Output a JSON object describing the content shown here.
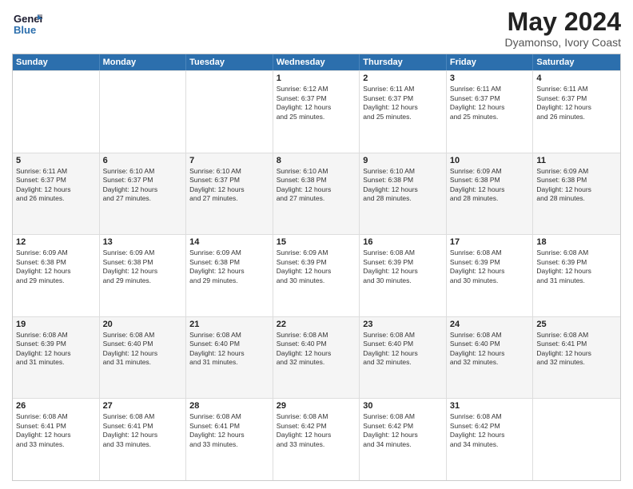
{
  "header": {
    "month_title": "May 2024",
    "location": "Dyamonso, Ivory Coast",
    "logo_general": "General",
    "logo_blue": "Blue"
  },
  "weekdays": [
    "Sunday",
    "Monday",
    "Tuesday",
    "Wednesday",
    "Thursday",
    "Friday",
    "Saturday"
  ],
  "rows": [
    [
      {
        "day": "",
        "info": ""
      },
      {
        "day": "",
        "info": ""
      },
      {
        "day": "",
        "info": ""
      },
      {
        "day": "1",
        "info": "Sunrise: 6:12 AM\nSunset: 6:37 PM\nDaylight: 12 hours\nand 25 minutes."
      },
      {
        "day": "2",
        "info": "Sunrise: 6:11 AM\nSunset: 6:37 PM\nDaylight: 12 hours\nand 25 minutes."
      },
      {
        "day": "3",
        "info": "Sunrise: 6:11 AM\nSunset: 6:37 PM\nDaylight: 12 hours\nand 25 minutes."
      },
      {
        "day": "4",
        "info": "Sunrise: 6:11 AM\nSunset: 6:37 PM\nDaylight: 12 hours\nand 26 minutes."
      }
    ],
    [
      {
        "day": "5",
        "info": "Sunrise: 6:11 AM\nSunset: 6:37 PM\nDaylight: 12 hours\nand 26 minutes."
      },
      {
        "day": "6",
        "info": "Sunrise: 6:10 AM\nSunset: 6:37 PM\nDaylight: 12 hours\nand 27 minutes."
      },
      {
        "day": "7",
        "info": "Sunrise: 6:10 AM\nSunset: 6:37 PM\nDaylight: 12 hours\nand 27 minutes."
      },
      {
        "day": "8",
        "info": "Sunrise: 6:10 AM\nSunset: 6:38 PM\nDaylight: 12 hours\nand 27 minutes."
      },
      {
        "day": "9",
        "info": "Sunrise: 6:10 AM\nSunset: 6:38 PM\nDaylight: 12 hours\nand 28 minutes."
      },
      {
        "day": "10",
        "info": "Sunrise: 6:09 AM\nSunset: 6:38 PM\nDaylight: 12 hours\nand 28 minutes."
      },
      {
        "day": "11",
        "info": "Sunrise: 6:09 AM\nSunset: 6:38 PM\nDaylight: 12 hours\nand 28 minutes."
      }
    ],
    [
      {
        "day": "12",
        "info": "Sunrise: 6:09 AM\nSunset: 6:38 PM\nDaylight: 12 hours\nand 29 minutes."
      },
      {
        "day": "13",
        "info": "Sunrise: 6:09 AM\nSunset: 6:38 PM\nDaylight: 12 hours\nand 29 minutes."
      },
      {
        "day": "14",
        "info": "Sunrise: 6:09 AM\nSunset: 6:38 PM\nDaylight: 12 hours\nand 29 minutes."
      },
      {
        "day": "15",
        "info": "Sunrise: 6:09 AM\nSunset: 6:39 PM\nDaylight: 12 hours\nand 30 minutes."
      },
      {
        "day": "16",
        "info": "Sunrise: 6:08 AM\nSunset: 6:39 PM\nDaylight: 12 hours\nand 30 minutes."
      },
      {
        "day": "17",
        "info": "Sunrise: 6:08 AM\nSunset: 6:39 PM\nDaylight: 12 hours\nand 30 minutes."
      },
      {
        "day": "18",
        "info": "Sunrise: 6:08 AM\nSunset: 6:39 PM\nDaylight: 12 hours\nand 31 minutes."
      }
    ],
    [
      {
        "day": "19",
        "info": "Sunrise: 6:08 AM\nSunset: 6:39 PM\nDaylight: 12 hours\nand 31 minutes."
      },
      {
        "day": "20",
        "info": "Sunrise: 6:08 AM\nSunset: 6:40 PM\nDaylight: 12 hours\nand 31 minutes."
      },
      {
        "day": "21",
        "info": "Sunrise: 6:08 AM\nSunset: 6:40 PM\nDaylight: 12 hours\nand 31 minutes."
      },
      {
        "day": "22",
        "info": "Sunrise: 6:08 AM\nSunset: 6:40 PM\nDaylight: 12 hours\nand 32 minutes."
      },
      {
        "day": "23",
        "info": "Sunrise: 6:08 AM\nSunset: 6:40 PM\nDaylight: 12 hours\nand 32 minutes."
      },
      {
        "day": "24",
        "info": "Sunrise: 6:08 AM\nSunset: 6:40 PM\nDaylight: 12 hours\nand 32 minutes."
      },
      {
        "day": "25",
        "info": "Sunrise: 6:08 AM\nSunset: 6:41 PM\nDaylight: 12 hours\nand 32 minutes."
      }
    ],
    [
      {
        "day": "26",
        "info": "Sunrise: 6:08 AM\nSunset: 6:41 PM\nDaylight: 12 hours\nand 33 minutes."
      },
      {
        "day": "27",
        "info": "Sunrise: 6:08 AM\nSunset: 6:41 PM\nDaylight: 12 hours\nand 33 minutes."
      },
      {
        "day": "28",
        "info": "Sunrise: 6:08 AM\nSunset: 6:41 PM\nDaylight: 12 hours\nand 33 minutes."
      },
      {
        "day": "29",
        "info": "Sunrise: 6:08 AM\nSunset: 6:42 PM\nDaylight: 12 hours\nand 33 minutes."
      },
      {
        "day": "30",
        "info": "Sunrise: 6:08 AM\nSunset: 6:42 PM\nDaylight: 12 hours\nand 34 minutes."
      },
      {
        "day": "31",
        "info": "Sunrise: 6:08 AM\nSunset: 6:42 PM\nDaylight: 12 hours\nand 34 minutes."
      },
      {
        "day": "",
        "info": ""
      }
    ]
  ]
}
